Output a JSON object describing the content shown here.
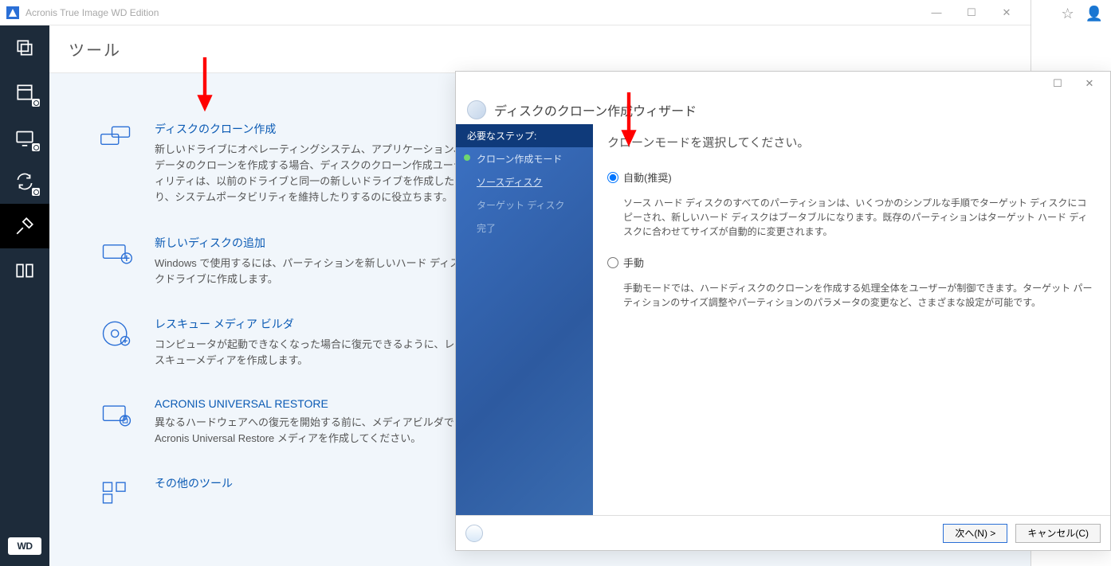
{
  "app": {
    "title": "Acronis True Image WD Edition",
    "page_title": "ツール"
  },
  "navrail": {
    "wd_label": "WD"
  },
  "tools": {
    "clone": {
      "title": "ディスクのクローン作成",
      "desc": "新しいドライブにオペレーティングシステム、アプリケーション、データのクローンを作成する場合、ディスクのクローン作成ユーティリティは、以前のドライブと同一の新しいドライブを作成したり、システムポータビリティを維持したりするのに役立ちます。"
    },
    "adddisk": {
      "title": "新しいディスクの追加",
      "desc": "Windows で使用するには、パーティションを新しいハード ディスクドライブに作成します。"
    },
    "rescue": {
      "title": "レスキュー メディア ビルダ",
      "desc": "コンピュータが起動できなくなった場合に復元できるように、レスキューメディアを作成します。"
    },
    "aur": {
      "title": "ACRONIS UNIVERSAL RESTORE",
      "desc": "異なるハードウェアへの復元を開始する前に、メディアビルダで Acronis Universal Restore メディアを作成してください。"
    },
    "other": {
      "title": "その他のツール"
    }
  },
  "wizard": {
    "title": "ディスクのクローン作成ウィザード",
    "steps_header": "必要なステップ:",
    "steps": {
      "mode": "クローン作成モード",
      "source": "ソースディスク",
      "target": "ターゲット ディスク",
      "finish": "完了"
    },
    "heading": "クローンモードを選択してください。",
    "auto": {
      "label": "自動(推奨)",
      "desc": "ソース ハード ディスクのすべてのパーティションは、いくつかのシンプルな手順でターゲット ディスクにコピーされ、新しいハード ディスクはブータブルになります。既存のパーティションはターゲット ハード ディスクに合わせてサイズが自動的に変更されます。"
    },
    "manual": {
      "label": "手動",
      "desc": "手動モードでは、ハードディスクのクローンを作成する処理全体をユーザーが制御できます。ターゲット パーティションのサイズ調整やパーティションのパラメータの変更など、さまざまな設定が可能です。"
    },
    "buttons": {
      "next": "次へ(N) >",
      "cancel": "キャンセル(C)"
    }
  }
}
